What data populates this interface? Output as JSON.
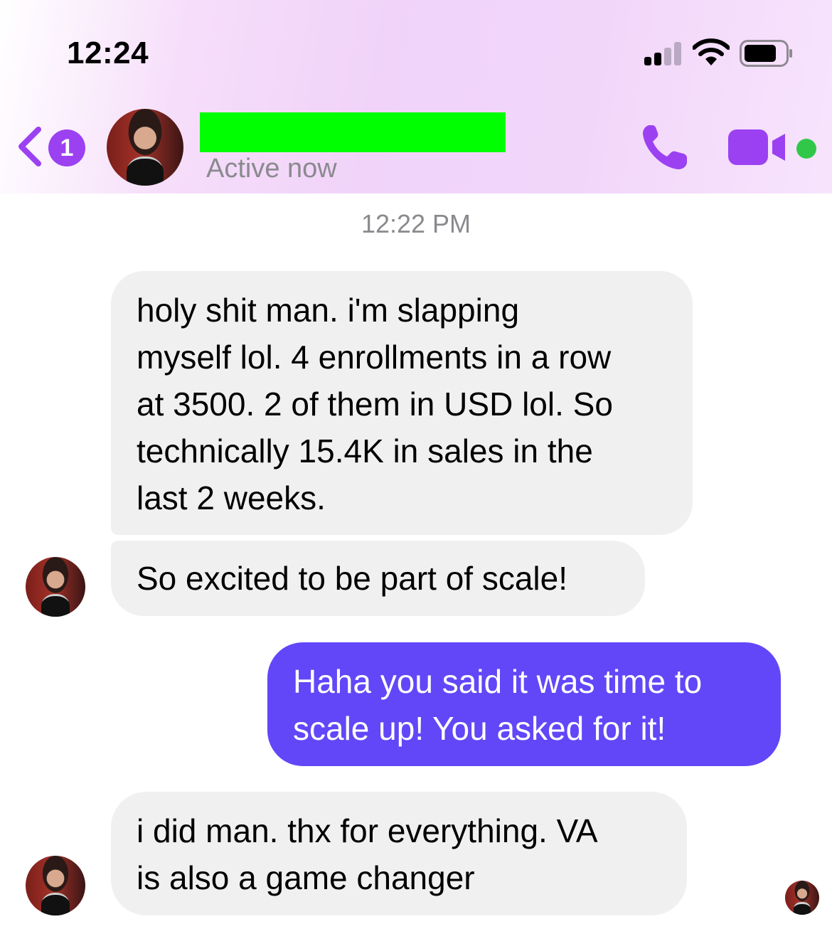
{
  "status_bar": {
    "time": "12:24",
    "signal_icon": "cellular-signal-icon",
    "wifi_icon": "wifi-icon",
    "battery_icon": "battery-icon"
  },
  "header": {
    "back_badge_count": "1",
    "contact_name_redacted": "",
    "status": "Active now",
    "accent_color": "#9b41f2",
    "online_color": "#31c84a",
    "icons": [
      "chevron-left-icon",
      "phone-icon",
      "video-camera-icon"
    ]
  },
  "conversation": {
    "timestamp": "12:22 PM",
    "messages": [
      {
        "sender": "contact",
        "lines": [
          "holy shit man. i'm slapping",
          "myself lol. 4 enrollments in a row",
          "at 3500. 2 of them in USD lol. So",
          "technically 15.4K in sales in the",
          "last 2 weeks."
        ]
      },
      {
        "sender": "contact",
        "lines": [
          "So excited to be part of scale!"
        ]
      },
      {
        "sender": "me",
        "lines": [
          "Haha you said it was time to",
          "scale up! You asked for it!"
        ]
      },
      {
        "sender": "contact",
        "lines": [
          "i did man. thx for everything. VA",
          "is also a game changer"
        ]
      }
    ],
    "incoming_bubble_color": "#f0f0f0",
    "outgoing_bubble_color": "#6147f8"
  }
}
